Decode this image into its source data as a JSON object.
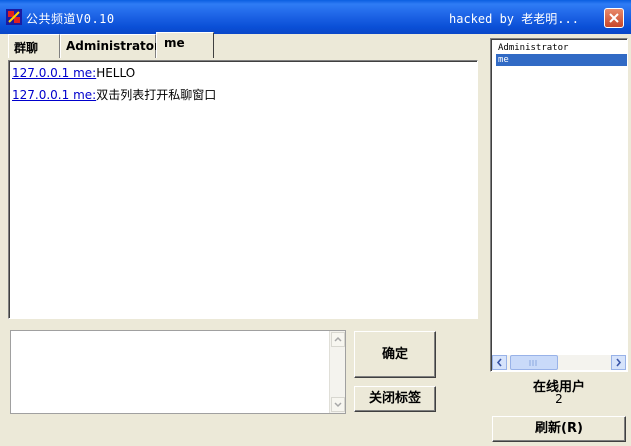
{
  "window": {
    "title": "公共频道V0.10",
    "title_right": "hacked by 老老明..."
  },
  "tabs": [
    {
      "label": "群聊"
    },
    {
      "label": "Administrator"
    },
    {
      "label": "me"
    }
  ],
  "messages": [
    {
      "sender": "127.0.0.1 me:",
      "text": "HELLO"
    },
    {
      "sender": "127.0.0.1 me:",
      "text": "双击列表打开私聊窗口"
    }
  ],
  "input": {
    "value": ""
  },
  "buttons": {
    "confirm": "确定",
    "close_tab": "关闭标签",
    "refresh": "刷新(R)"
  },
  "users": [
    {
      "name": "Administrator",
      "selected": false
    },
    {
      "name": "me",
      "selected": true
    }
  ],
  "online": {
    "label": "在线用户",
    "count": "2"
  },
  "colors": {
    "titlebar": "#0A5EE0",
    "selection": "#316AC5",
    "link": "#0000CC",
    "close_button": "#C8462A"
  }
}
